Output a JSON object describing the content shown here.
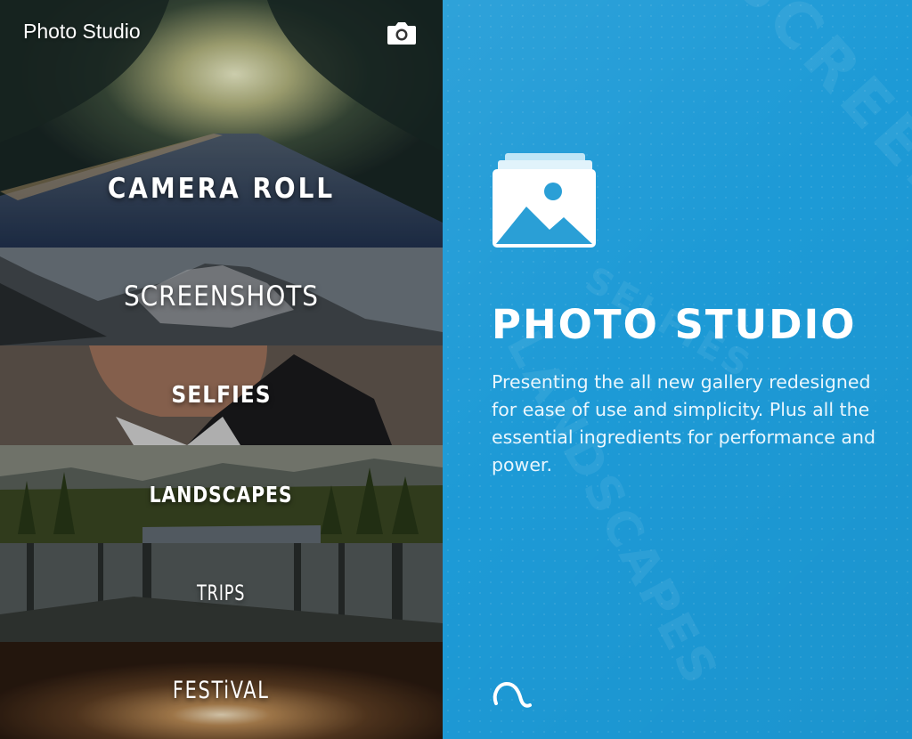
{
  "header": {
    "app_title": "Photo Studio",
    "camera_icon": "camera-icon"
  },
  "albums": [
    {
      "label": "CAMERA ROLL"
    },
    {
      "label": "SCREENSHOTS"
    },
    {
      "label": "SELFIES"
    },
    {
      "label": "LANDSCAPES"
    },
    {
      "label": "TRIPS"
    },
    {
      "label": "FESTiVAL"
    }
  ],
  "promo": {
    "icon": "gallery-icon",
    "title": "PHOTO STUDIO",
    "description": "Presenting the all new gallery redesigned for ease of use and simplicity. Plus all the essential ingredients for performance and power.",
    "watermarks": [
      "SCREENSHOTS",
      "LANDSCAPES",
      "SELFIES"
    ],
    "logo_icon": "brand-logo-icon"
  },
  "colors": {
    "panel_blue": "#1d9ad6",
    "icon_blue": "#2a9fd6",
    "text_white": "#ffffff"
  }
}
